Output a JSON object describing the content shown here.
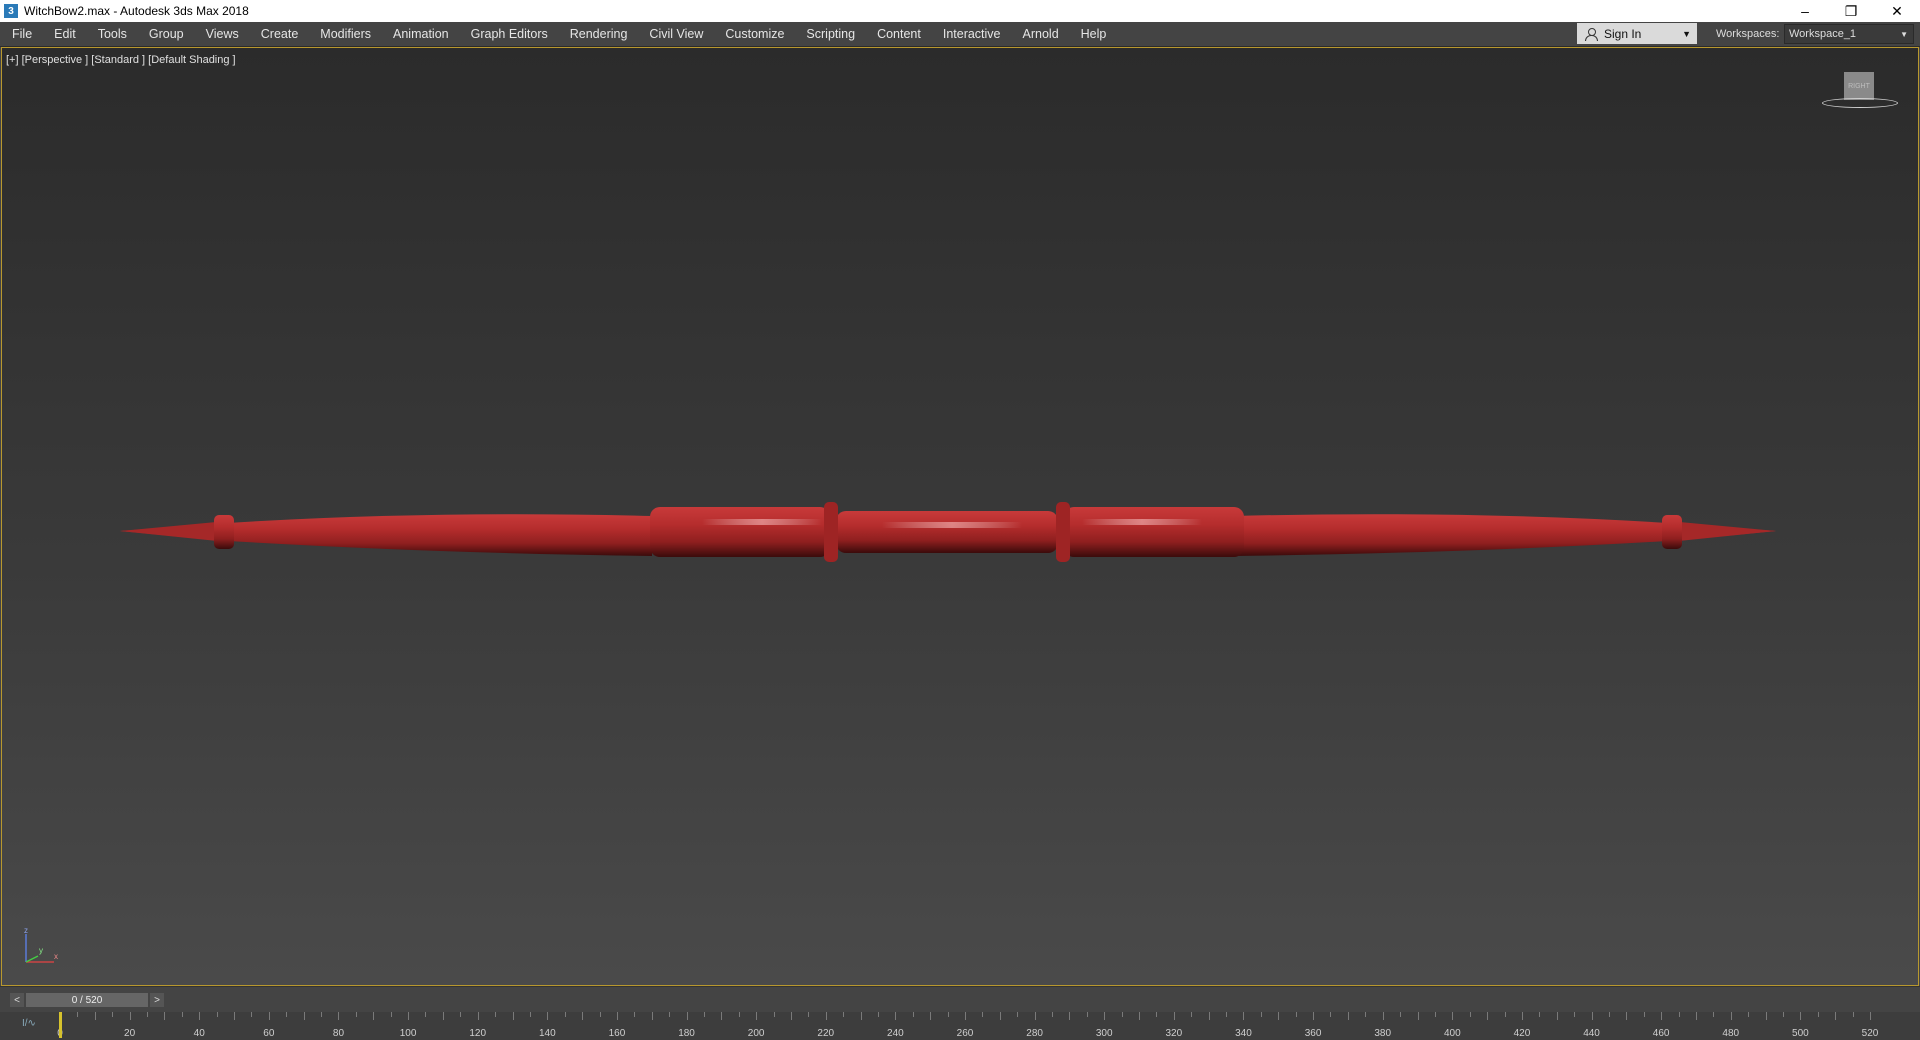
{
  "window": {
    "title": "WitchBow2.max - Autodesk 3ds Max 2018",
    "app_icon_glyph": "3",
    "controls": [
      "–",
      "❐",
      "✕"
    ]
  },
  "menu": [
    "File",
    "Edit",
    "Tools",
    "Group",
    "Views",
    "Create",
    "Modifiers",
    "Animation",
    "Graph Editors",
    "Rendering",
    "Civil View",
    "Customize",
    "Scripting",
    "Content",
    "Interactive",
    "Arnold",
    "Help"
  ],
  "signin": {
    "label": "Sign In",
    "icon": "user-icon"
  },
  "workspaces": {
    "label": "Workspaces:",
    "value": "Workspace_1"
  },
  "viewport": {
    "label": "[+] [Perspective ] [Standard ] [Default Shading ]",
    "viewcube_face": "RIGHT",
    "object_color": "#b22a2a",
    "axis_labels": {
      "z": "z",
      "x": "x",
      "y": "y"
    }
  },
  "timeslider": {
    "value": "0 / 520",
    "prev": "<",
    "next": ">"
  },
  "trackbar": {
    "icon": "curve-editor-icon",
    "icon_glyph": "I/∿",
    "min": 0,
    "max": 520,
    "labels": [
      "0",
      "20",
      "40",
      "60",
      "80",
      "100",
      "120",
      "140",
      "160",
      "180",
      "200",
      "220",
      "240",
      "260",
      "280",
      "300",
      "320",
      "340",
      "360",
      "380",
      "400",
      "420",
      "440",
      "460",
      "480",
      "500",
      "520"
    ],
    "current_frame": 0,
    "marker_color": "#d6c22d"
  }
}
